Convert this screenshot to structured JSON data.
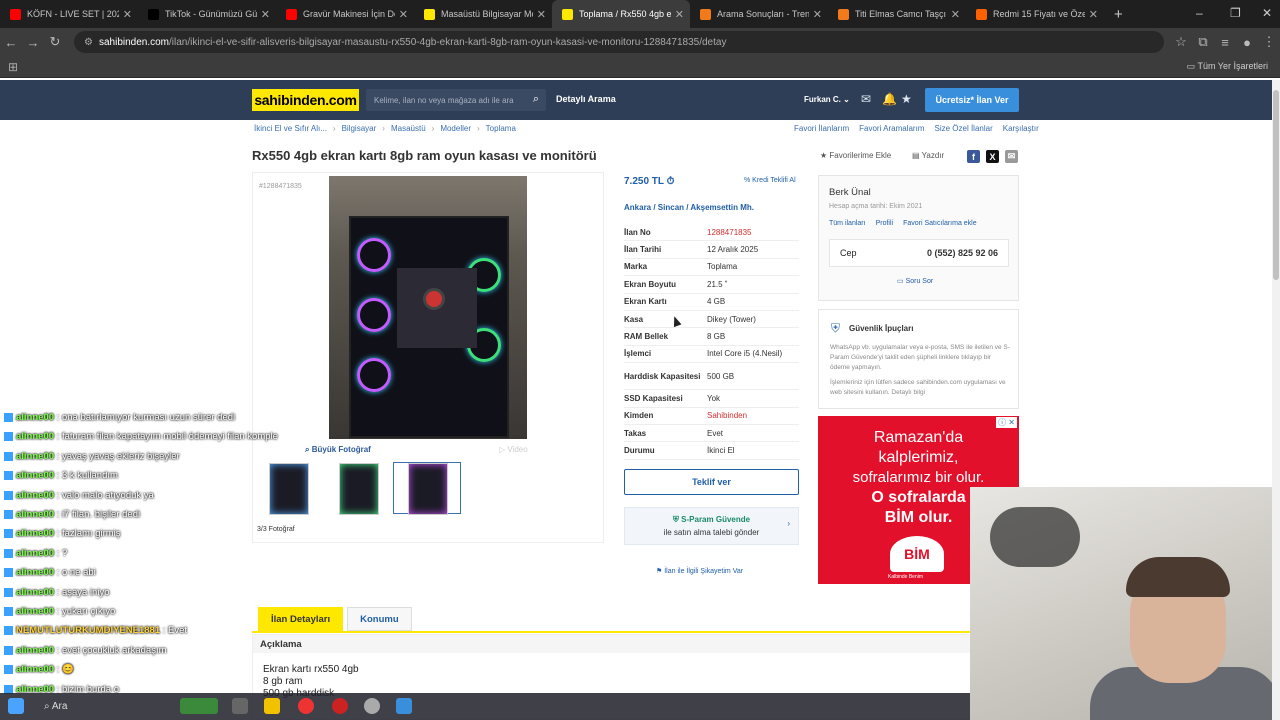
{
  "browser": {
    "tabs": [
      {
        "title": "KÖFN - LIVE SET | 2023 -",
        "icon": "youtube-icon",
        "color": "#ff0000"
      },
      {
        "title": "TikTok - Günümüzü Güzel",
        "icon": "tiktok-icon",
        "color": "#000000"
      },
      {
        "title": "Gravür Makinesi İçin Doğr",
        "icon": "youtube-icon",
        "color": "#ff0000"
      },
      {
        "title": "Masaüstü Bilgisayar Mod",
        "icon": "sahibinden-icon",
        "color": "#ffe800"
      },
      {
        "title": "Toplama / Rx550 4gb ekr",
        "icon": "sahibinden-icon",
        "color": "#ffe800",
        "active": true
      },
      {
        "title": "Arama Sonuçları - Trendy",
        "icon": "trendyol-icon",
        "color": "#f27a1a"
      },
      {
        "title": "Titi Elmas Camcı Taşçı Gra",
        "icon": "trendyol-icon",
        "color": "#f27a1a"
      },
      {
        "title": "Redmi 15 Fiyatı ve Özellik",
        "icon": "hepsiburada-icon",
        "color": "#ff6000"
      }
    ],
    "url_host": "sahibinden.com",
    "url_path": "/ilan/ikinci-el-ve-sifir-alisveris-bilgisayar-masaustu-rx550-4gb-ekran-karti-8gb-ram-oyun-kasasi-ve-monitoru-1288471835/detay",
    "bookmarks_all": "Tüm Yer İşaretleri"
  },
  "header": {
    "logo": "sahibinden.com",
    "search_placeholder": "Kelime, ilan no veya mağaza adı ile ara",
    "detailed_search": "Detaylı Arama",
    "user": "Furkan C.",
    "post_ad": "Ücretsiz* İlan Ver"
  },
  "breadcrumb": [
    "İkinci El ve Sıfır Alı...",
    "Bilgisayar",
    "Masaüstü",
    "Modeller",
    "Toplama"
  ],
  "right_links": [
    "Favori İlanlarım",
    "Favori Aramalarım",
    "Size Özel İlanlar",
    "Karşılaştır"
  ],
  "listing": {
    "title": "Rx550 4gb ekran kartı 8gb ram oyun kasası ve monitörü",
    "add_favorite": "Favorilerime Ekle",
    "print": "Yazdır",
    "number_tag": "#1288471835",
    "big_photo": "Büyük Fotoğraf",
    "video": "Video",
    "photo_count": "3/3 Fotoğraf",
    "price": "7.250 TL",
    "credit_offer": "Kredi Teklifi Al",
    "location": [
      "Ankara",
      "Sincan",
      "Akşemsettin Mh."
    ],
    "attributes": [
      {
        "k": "İlan No",
        "v": "1288471835",
        "red": true
      },
      {
        "k": "İlan Tarihi",
        "v": "12 Aralık 2025"
      },
      {
        "k": "Marka",
        "v": "Toplama"
      },
      {
        "k": "Ekran Boyutu",
        "v": "21.5 ˮ"
      },
      {
        "k": "Ekran Kartı",
        "v": "4 GB"
      },
      {
        "k": "Kasa",
        "v": "Dikey (Tower)"
      },
      {
        "k": "RAM Bellek",
        "v": "8 GB"
      },
      {
        "k": "İşlemci",
        "v": "Intel Core i5 (4.Nesil)"
      },
      {
        "k": "Harddisk Kapasitesi",
        "v": "500 GB"
      },
      {
        "k": "SSD Kapasitesi",
        "v": "Yok"
      },
      {
        "k": "Kimden",
        "v": "Sahibinden",
        "red": true
      },
      {
        "k": "Takas",
        "v": "Evet"
      },
      {
        "k": "Durumu",
        "v": "İkinci El"
      }
    ],
    "offer_button": "Teklif ver",
    "sparam_title": "S-Param Güvende",
    "sparam_sub": "ile satın alma talebi gönder",
    "complain": "İlan ile İlgili Şikayetim Var"
  },
  "seller": {
    "name": "Berk Ünal",
    "since": "Hesap açma tarihi: Ekim 2021",
    "links": [
      "Tüm ilanları",
      "Profili",
      "Favori Satıcılarıma ekle"
    ],
    "phone_label": "Cep",
    "phone": "0 (552) 825 92 06",
    "ask": "Soru Sor"
  },
  "safety": {
    "title": "Güvenlik İpuçları",
    "p1": "WhatsApp vb. uygulamalar veya e-posta, SMS ile iletilen ve S-Param Güvende'yi taklit eden şüpheli linklere tıklayıp bir ödeme yapmayın.",
    "p2": "İşlemleriniz için lütfen sadece sahibinden.com uygulaması ve web sitesini kullanın. Detaylı bilgi"
  },
  "ad": {
    "lines": [
      "Ramazan'da",
      "kalplerimiz,",
      "sofralarımız bir olur."
    ],
    "bold_lines": [
      "O sofralarda",
      "BİM olur."
    ],
    "brand": "BİM",
    "tag": "Kalbinde Benim"
  },
  "tabs": [
    "İlan Detayları",
    "Konumu"
  ],
  "description": {
    "heading": "Açıklama",
    "lines": [
      "Ekran kartı rx550 4gb",
      "8 gb ram",
      "500 gb harddisk"
    ]
  },
  "chat": [
    {
      "u": "alinne00",
      "m": ": ona batırlamıyor kurması uzun sürer dedi"
    },
    {
      "u": "alinne00",
      "m": ": faturam filan kapatayım mobil ödemeyi filan komple"
    },
    {
      "u": "alinne00",
      "m": ": yavaş yavaş ekleriz bişeyler"
    },
    {
      "u": "alinne00",
      "m": ": 3 k kullandım"
    },
    {
      "u": "alinne00",
      "m": ": valo malo atıyoduk ya"
    },
    {
      "u": "alinne00",
      "m": ": i7 filan. bişiler dedi"
    },
    {
      "u": "alinne00",
      "m": ": fazlamı girmiş"
    },
    {
      "u": "alinne00",
      "m": ": ?"
    },
    {
      "u": "alinne00",
      "m": ": o ne abi"
    },
    {
      "u": "alinne00",
      "m": ": aşaya iniyo"
    },
    {
      "u": "alinne00",
      "m": ": yukarı çıkıyo"
    },
    {
      "u": "NEMUTLUTURKUMDIYENE1881",
      "m": ": Evet",
      "alt": true
    },
    {
      "u": "alinne00",
      "m": ": evet çocukluk arkadaşım"
    },
    {
      "u": "alinne00",
      "m": ": 😊"
    },
    {
      "u": "alinne00",
      "m": ": bizim burda o"
    }
  ]
}
